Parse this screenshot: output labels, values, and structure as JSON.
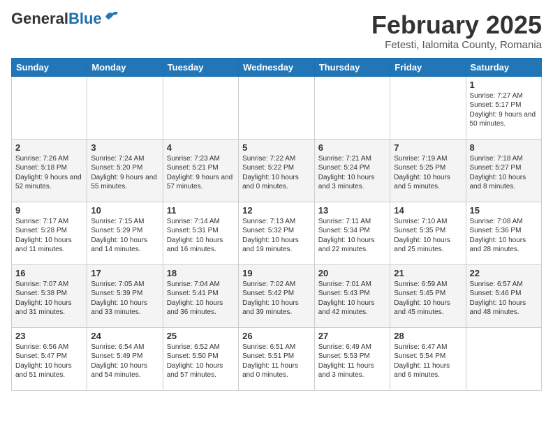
{
  "header": {
    "logo_general": "General",
    "logo_blue": "Blue",
    "month_title": "February 2025",
    "subtitle": "Fetesti, Ialomita County, Romania"
  },
  "days_of_week": [
    "Sunday",
    "Monday",
    "Tuesday",
    "Wednesday",
    "Thursday",
    "Friday",
    "Saturday"
  ],
  "weeks": [
    [
      {
        "day": null
      },
      {
        "day": null
      },
      {
        "day": null
      },
      {
        "day": null
      },
      {
        "day": null
      },
      {
        "day": null
      },
      {
        "day": "1",
        "info": "Sunrise: 7:27 AM\nSunset: 5:17 PM\nDaylight: 9 hours\nand 50 minutes."
      }
    ],
    [
      {
        "day": "2",
        "info": "Sunrise: 7:26 AM\nSunset: 5:18 PM\nDaylight: 9 hours\nand 52 minutes."
      },
      {
        "day": "3",
        "info": "Sunrise: 7:24 AM\nSunset: 5:20 PM\nDaylight: 9 hours\nand 55 minutes."
      },
      {
        "day": "4",
        "info": "Sunrise: 7:23 AM\nSunset: 5:21 PM\nDaylight: 9 hours\nand 57 minutes."
      },
      {
        "day": "5",
        "info": "Sunrise: 7:22 AM\nSunset: 5:22 PM\nDaylight: 10 hours\nand 0 minutes."
      },
      {
        "day": "6",
        "info": "Sunrise: 7:21 AM\nSunset: 5:24 PM\nDaylight: 10 hours\nand 3 minutes."
      },
      {
        "day": "7",
        "info": "Sunrise: 7:19 AM\nSunset: 5:25 PM\nDaylight: 10 hours\nand 5 minutes."
      },
      {
        "day": "8",
        "info": "Sunrise: 7:18 AM\nSunset: 5:27 PM\nDaylight: 10 hours\nand 8 minutes."
      }
    ],
    [
      {
        "day": "9",
        "info": "Sunrise: 7:17 AM\nSunset: 5:28 PM\nDaylight: 10 hours\nand 11 minutes."
      },
      {
        "day": "10",
        "info": "Sunrise: 7:15 AM\nSunset: 5:29 PM\nDaylight: 10 hours\nand 14 minutes."
      },
      {
        "day": "11",
        "info": "Sunrise: 7:14 AM\nSunset: 5:31 PM\nDaylight: 10 hours\nand 16 minutes."
      },
      {
        "day": "12",
        "info": "Sunrise: 7:13 AM\nSunset: 5:32 PM\nDaylight: 10 hours\nand 19 minutes."
      },
      {
        "day": "13",
        "info": "Sunrise: 7:11 AM\nSunset: 5:34 PM\nDaylight: 10 hours\nand 22 minutes."
      },
      {
        "day": "14",
        "info": "Sunrise: 7:10 AM\nSunset: 5:35 PM\nDaylight: 10 hours\nand 25 minutes."
      },
      {
        "day": "15",
        "info": "Sunrise: 7:08 AM\nSunset: 5:36 PM\nDaylight: 10 hours\nand 28 minutes."
      }
    ],
    [
      {
        "day": "16",
        "info": "Sunrise: 7:07 AM\nSunset: 5:38 PM\nDaylight: 10 hours\nand 31 minutes."
      },
      {
        "day": "17",
        "info": "Sunrise: 7:05 AM\nSunset: 5:39 PM\nDaylight: 10 hours\nand 33 minutes."
      },
      {
        "day": "18",
        "info": "Sunrise: 7:04 AM\nSunset: 5:41 PM\nDaylight: 10 hours\nand 36 minutes."
      },
      {
        "day": "19",
        "info": "Sunrise: 7:02 AM\nSunset: 5:42 PM\nDaylight: 10 hours\nand 39 minutes."
      },
      {
        "day": "20",
        "info": "Sunrise: 7:01 AM\nSunset: 5:43 PM\nDaylight: 10 hours\nand 42 minutes."
      },
      {
        "day": "21",
        "info": "Sunrise: 6:59 AM\nSunset: 5:45 PM\nDaylight: 10 hours\nand 45 minutes."
      },
      {
        "day": "22",
        "info": "Sunrise: 6:57 AM\nSunset: 5:46 PM\nDaylight: 10 hours\nand 48 minutes."
      }
    ],
    [
      {
        "day": "23",
        "info": "Sunrise: 6:56 AM\nSunset: 5:47 PM\nDaylight: 10 hours\nand 51 minutes."
      },
      {
        "day": "24",
        "info": "Sunrise: 6:54 AM\nSunset: 5:49 PM\nDaylight: 10 hours\nand 54 minutes."
      },
      {
        "day": "25",
        "info": "Sunrise: 6:52 AM\nSunset: 5:50 PM\nDaylight: 10 hours\nand 57 minutes."
      },
      {
        "day": "26",
        "info": "Sunrise: 6:51 AM\nSunset: 5:51 PM\nDaylight: 11 hours\nand 0 minutes."
      },
      {
        "day": "27",
        "info": "Sunrise: 6:49 AM\nSunset: 5:53 PM\nDaylight: 11 hours\nand 3 minutes."
      },
      {
        "day": "28",
        "info": "Sunrise: 6:47 AM\nSunset: 5:54 PM\nDaylight: 11 hours\nand 6 minutes."
      },
      {
        "day": null
      }
    ]
  ]
}
